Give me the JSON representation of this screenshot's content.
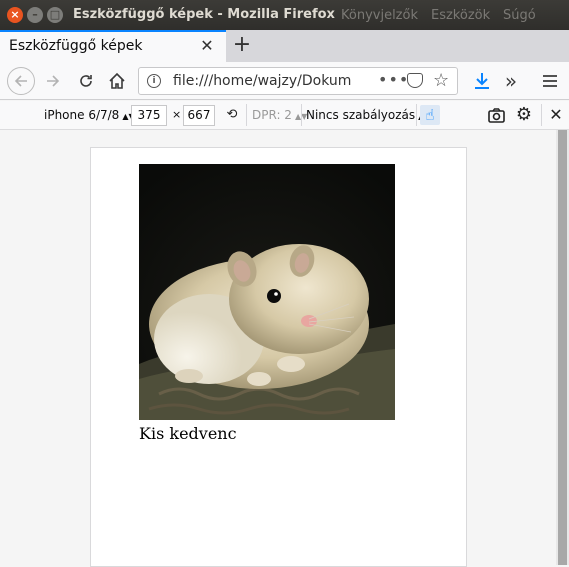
{
  "window": {
    "title": "Eszközfüggő képek - Mozilla Firefox",
    "menus": [
      "Könyvjelzők",
      "Eszközök",
      "Súgó"
    ]
  },
  "tabs": [
    {
      "label": "Eszközfüggő képek",
      "active": true
    }
  ],
  "navbar": {
    "url": "file:///home/wajzy/Dokum",
    "icons": [
      "back-arrow-icon",
      "forward-arrow-icon",
      "reload-icon",
      "home-icon",
      "info-icon",
      "more-icon",
      "pocket-icon",
      "star-icon",
      "download-icon",
      "overflow-icon",
      "hamburger-menu-icon"
    ]
  },
  "rdm": {
    "device": "iPhone 6/7/8",
    "width": "375",
    "times": "×",
    "height": "667",
    "dpr": "DPR: 2",
    "throttling": "Nincs szabályozás"
  },
  "page": {
    "caption": "Kis kedvenc"
  },
  "colors": {
    "accent": "#0a84ff",
    "titlebar": "#3c3b37",
    "close_button": "#e95420"
  }
}
